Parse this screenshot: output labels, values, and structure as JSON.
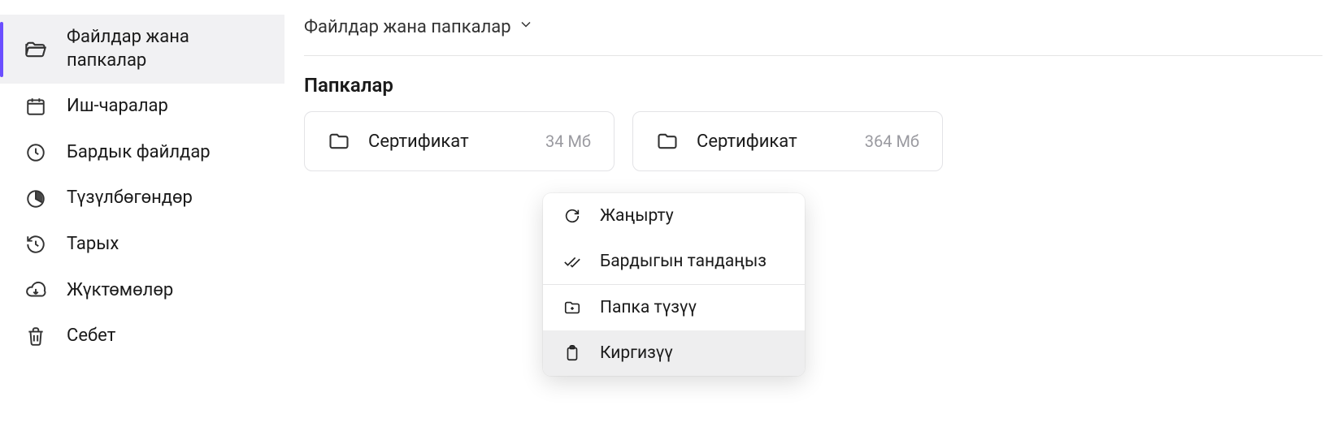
{
  "sidebar": {
    "items": [
      {
        "label": "Файлдар жана папкалар",
        "icon": "folder-open-icon",
        "active": true
      },
      {
        "label": "Иш-чаралар",
        "icon": "calendar-icon"
      },
      {
        "label": "Бардык файлдар",
        "icon": "clock-icon"
      },
      {
        "label": "Түзүлбөгөндөр",
        "icon": "pie-icon"
      },
      {
        "label": "Тарых",
        "icon": "history-icon"
      },
      {
        "label": "Жүктөмөлөр",
        "icon": "download-cloud-icon"
      },
      {
        "label": "Себет",
        "icon": "trash-icon"
      }
    ]
  },
  "breadcrumb": {
    "label": "Файлдар жана папкалар"
  },
  "section": {
    "heading": "Папкалар"
  },
  "folders": [
    {
      "name": "Сертификат",
      "size": "34 Мб"
    },
    {
      "name": "Сертификат",
      "size": "364 Мб"
    }
  ],
  "context_menu": {
    "items": [
      {
        "label": "Жаңырту",
        "icon": "refresh-icon"
      },
      {
        "label": "Бардыгын тандаңыз",
        "icon": "check-all-icon"
      },
      {
        "label": "Папка түзүү",
        "icon": "new-folder-icon",
        "sep_before": true
      },
      {
        "label": "Киргизүү",
        "icon": "clipboard-icon",
        "hover": true
      }
    ]
  }
}
